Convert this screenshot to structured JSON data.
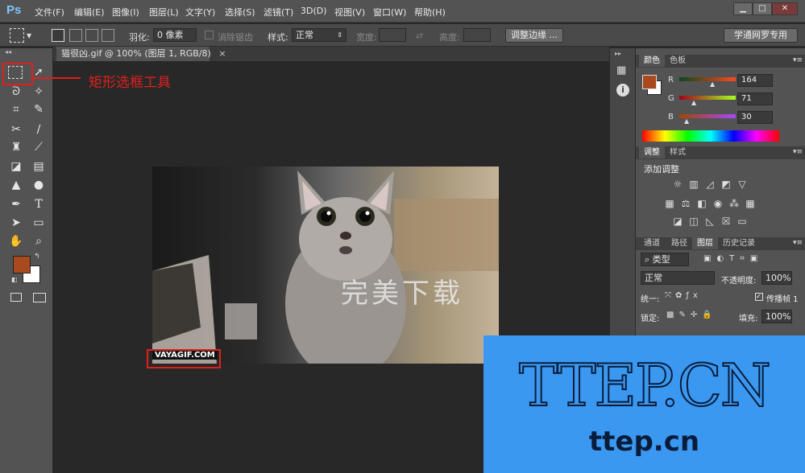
{
  "app": {
    "logo": "Ps"
  },
  "menu": [
    "文件(F)",
    "编辑(E)",
    "图像(I)",
    "图层(L)",
    "文字(Y)",
    "选择(S)",
    "滤镜(T)",
    "3D(D)",
    "视图(V)",
    "窗口(W)",
    "帮助(H)"
  ],
  "window_controls": {
    "minimize": "▁",
    "maximize": "□",
    "close": "✕"
  },
  "options": {
    "feather_label": "羽化:",
    "feather_value": "0 像素",
    "antialias_label": "消除锯齿",
    "style_label": "样式:",
    "style_value": "正常",
    "width_label": "宽度:",
    "height_label": "高度:",
    "refine_edge": "调整边缘 ...",
    "workspace": "学通网罗专用"
  },
  "document": {
    "tab_title": "猫很凶.gif @ 100% (图层 1, RGB/8)",
    "close": "×"
  },
  "canvas": {
    "watermark_text": "完美下载",
    "source_mark": "VAYAGIF.COM"
  },
  "annotation": {
    "label": "矩形选框工具"
  },
  "color_panel": {
    "tabs": [
      "颜色",
      "色板"
    ],
    "foreground": "#a84a1e",
    "sliders": [
      {
        "label": "R",
        "value": "164"
      },
      {
        "label": "G",
        "value": "71"
      },
      {
        "label": "B",
        "value": "30"
      }
    ]
  },
  "adjust_panel": {
    "tabs": [
      "调整",
      "样式"
    ],
    "title": "添加调整"
  },
  "layers_panel": {
    "tabs": [
      "通道",
      "路径",
      "图层",
      "历史记录"
    ],
    "filter_value": "类型",
    "blend_mode": "正常",
    "opacity_label": "不透明度:",
    "opacity_value": "100%",
    "unify_label": "统一:",
    "propagate_label": "传播帧 1",
    "lock_label": "锁定:",
    "fill_label": "填充:",
    "fill_value": "100%"
  },
  "brand": {
    "title": "TTEP.CN",
    "subtitle": "ttep.cn"
  }
}
